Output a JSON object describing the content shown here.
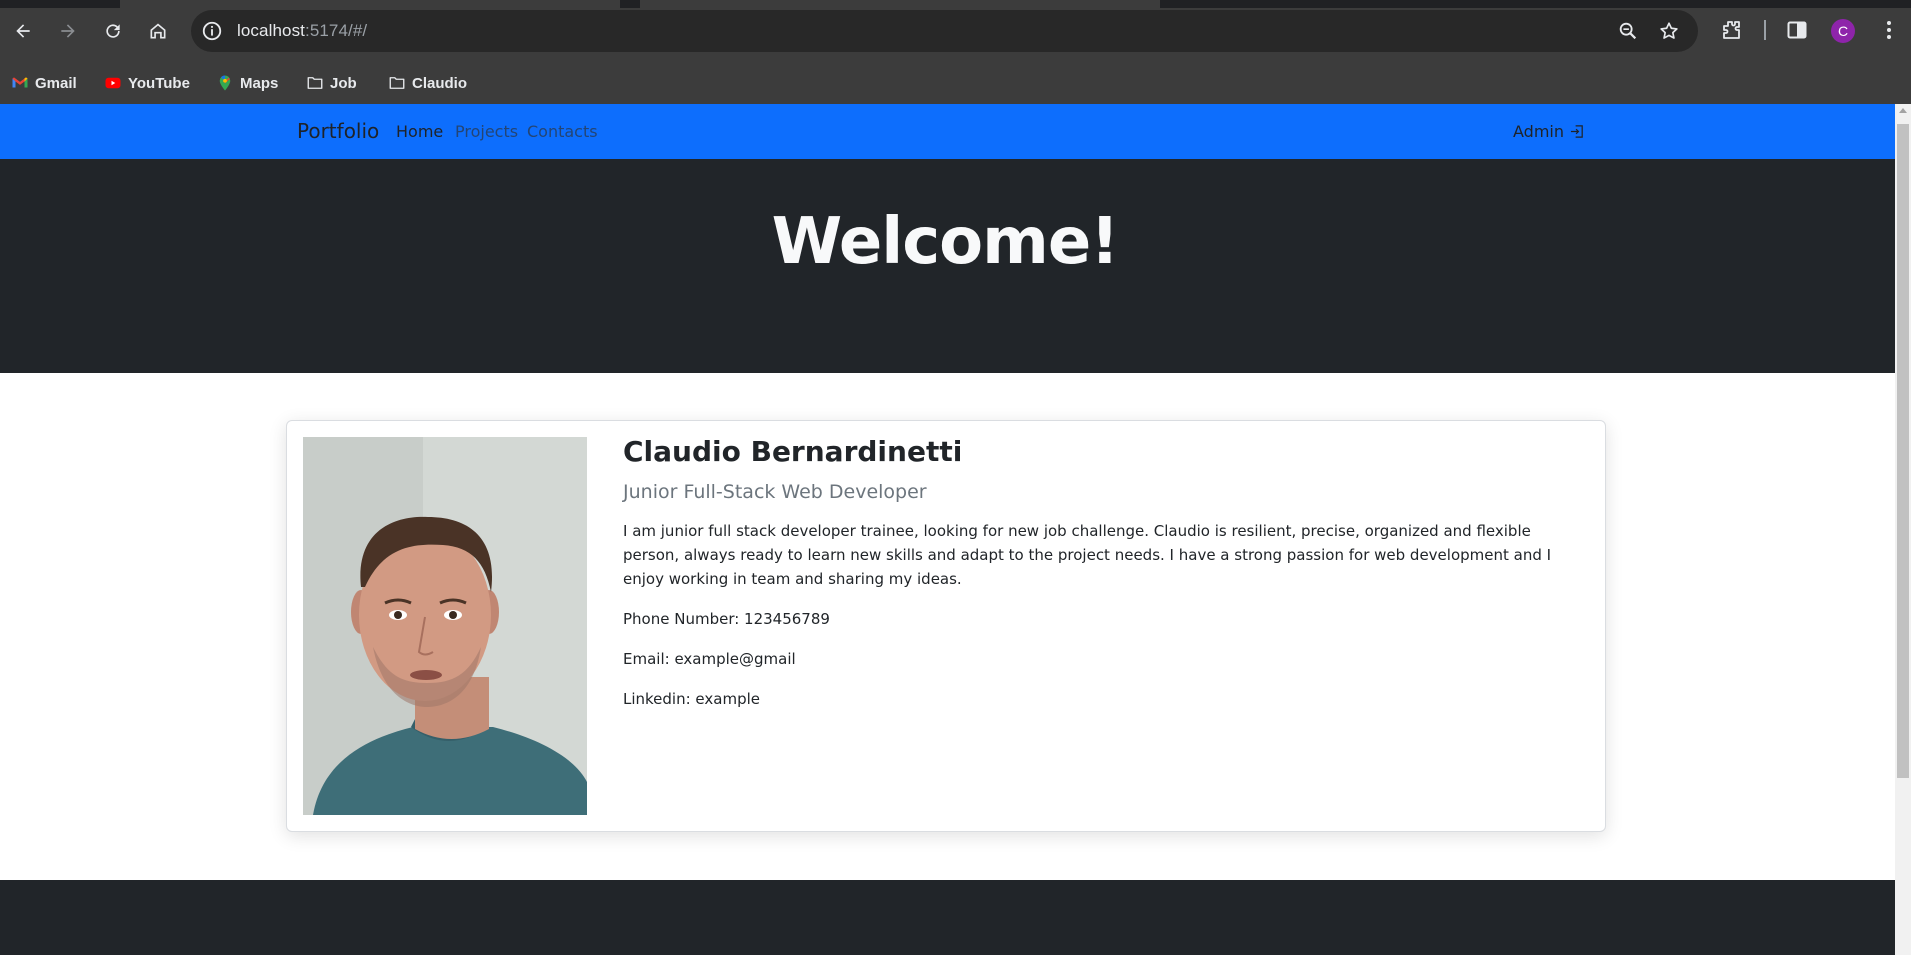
{
  "browser": {
    "url_host": "localhost",
    "url_path": ":5174/#/",
    "profile_initial": "C",
    "bookmarks": [
      {
        "label": "Gmail",
        "icon": "gmail-icon"
      },
      {
        "label": "YouTube",
        "icon": "youtube-icon"
      },
      {
        "label": "Maps",
        "icon": "maps-icon"
      },
      {
        "label": "Job",
        "icon": "folder-icon"
      },
      {
        "label": "Claudio",
        "icon": "folder-icon"
      }
    ]
  },
  "nav": {
    "brand": "Portfolio",
    "links": [
      "Home",
      "Projects",
      "Contacts"
    ],
    "admin": "Admin"
  },
  "hero": {
    "title": "Welcome!"
  },
  "profile": {
    "name": "Claudio Bernardinetti",
    "role": "Junior Full-Stack Web Developer",
    "bio": "I am junior full stack developer trainee, looking for new job challenge. Claudio is resilient, precise, organized and flexible person, always ready to learn new skills and adapt to the project needs. I have a strong passion for web development and I enjoy working in team and sharing my ideas.",
    "phone": "Phone Number: 123456789",
    "email": "Email: example@gmail",
    "linkedin": "Linkedin: example"
  },
  "colors": {
    "navbar": "#0d6efd",
    "hero_bg": "#212529",
    "chrome": "#3c3c3c",
    "avatar": "#8e24aa"
  }
}
